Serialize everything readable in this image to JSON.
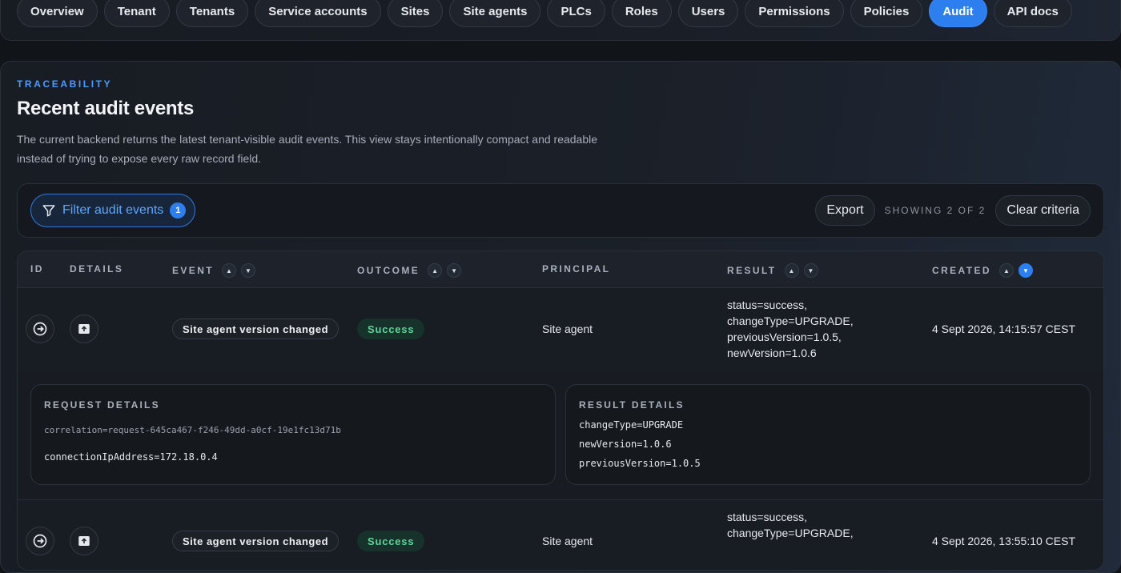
{
  "nav": {
    "tabs": [
      {
        "label": "Overview"
      },
      {
        "label": "Tenant"
      },
      {
        "label": "Tenants"
      },
      {
        "label": "Service accounts"
      },
      {
        "label": "Sites"
      },
      {
        "label": "Site agents"
      },
      {
        "label": "PLCs"
      },
      {
        "label": "Roles"
      },
      {
        "label": "Users"
      },
      {
        "label": "Permissions"
      },
      {
        "label": "Policies"
      },
      {
        "label": "Audit",
        "active": true
      },
      {
        "label": "API docs"
      }
    ]
  },
  "header": {
    "eyebrow": "TRACEABILITY",
    "title": "Recent audit events",
    "description": "The current backend returns the latest tenant-visible audit events. This view stays intentionally compact and readable instead of trying to expose every raw record field."
  },
  "toolbar": {
    "filter_label": "Filter audit events",
    "filter_count": "1",
    "export_label": "Export",
    "showing_text": "SHOWING 2 OF 2",
    "clear_label": "Clear criteria"
  },
  "table": {
    "columns": {
      "id": "ID",
      "details": "DETAILS",
      "event": "EVENT",
      "outcome": "OUTCOME",
      "principal": "PRINCIPAL",
      "result": "RESULT",
      "created": "CREATED"
    },
    "sort": {
      "column": "CREATED",
      "direction": "descending"
    },
    "rows": [
      {
        "event": "Site agent version changed",
        "outcome": "Success",
        "principal": "Site agent",
        "result_lines": [
          "status=success,",
          "changeType=UPGRADE,",
          "previousVersion=1.0.5,",
          "newVersion=1.0.6"
        ],
        "created": "4 Sept 2026, 14:15:57 CEST",
        "expanded": true,
        "request_details": {
          "title": "REQUEST DETAILS",
          "correlation": "correlation=request-645ca467-f246-49dd-a0cf-19e1fc13d71b",
          "ip": "connectionIpAddress=172.18.0.4"
        },
        "result_details": {
          "title": "RESULT DETAILS",
          "lines": [
            "changeType=UPGRADE",
            "newVersion=1.0.6",
            "previousVersion=1.0.5"
          ]
        }
      },
      {
        "event": "Site agent version changed",
        "outcome": "Success",
        "principal": "Site agent",
        "result_lines": [
          "status=success,",
          "changeType=UPGRADE,"
        ],
        "created": "4 Sept 2026, 13:55:10 CEST"
      }
    ]
  },
  "colors": {
    "accent": "#2d7ff0",
    "success_text": "#5fd49a",
    "success_bg": "#16322a",
    "eyebrow": "#4d9bff"
  },
  "icons": {
    "open_row": "arrow-right-circle-icon",
    "details": "upload-box-icon",
    "filter": "funnel-icon"
  }
}
